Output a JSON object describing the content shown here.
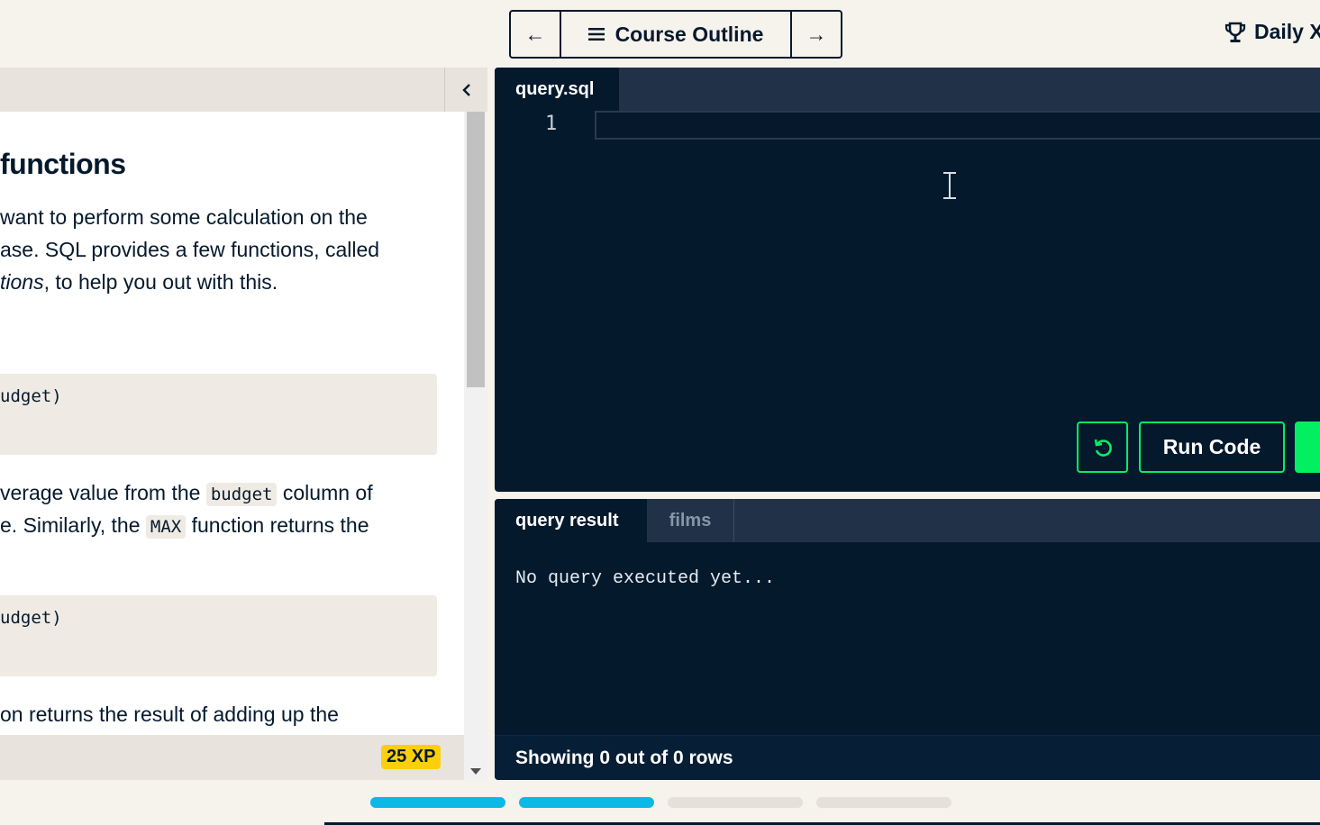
{
  "header": {
    "prev_label": "←",
    "outline_label": "Course Outline",
    "next_label": "→",
    "daily_label": "Daily X"
  },
  "lesson": {
    "heading": "functions",
    "para1": [
      "want to perform some calculation on the",
      "ase. SQL provides a few functions, called"
    ],
    "para1_line3_italic": "tions",
    "para1_line3_rest": ", to help you out with this.",
    "code1": "udget)",
    "para2_line1_pre": "verage value from the ",
    "para2_line1_code": "budget",
    "para2_line1_post": " column of",
    "para2_line2_pre": "e. Similarly, the ",
    "para2_line2_code": "MAX",
    "para2_line2_post": " function returns the",
    "code2": "udget)",
    "para3": "on returns the result of adding up the",
    "xp_badge": "25 XP"
  },
  "editor": {
    "tab": "query.sql",
    "line_number": "1",
    "code": "",
    "run_label": "Run Code"
  },
  "results": {
    "tabs": [
      "query result",
      "films"
    ],
    "empty_message": "No query executed yet...",
    "footer": "Showing 0 out of 0 rows"
  },
  "progress": {
    "segments": [
      {
        "state": "complete",
        "color": "#0bb9e6"
      },
      {
        "state": "complete",
        "color": "#0bb9e6"
      },
      {
        "state": "incomplete",
        "color": "#e5e1da"
      },
      {
        "state": "incomplete",
        "color": "#e5e1da"
      }
    ]
  },
  "colors": {
    "brand_green": "#03ef62",
    "navy": "#05192d",
    "xp_yellow": "#fcce0d"
  },
  "icons": {
    "prev": "arrow-left-icon",
    "outline": "menu-icon",
    "next": "arrow-right-icon",
    "daily": "trophy-icon",
    "collapse": "chevron-left-icon",
    "reset": "reset-icon"
  }
}
